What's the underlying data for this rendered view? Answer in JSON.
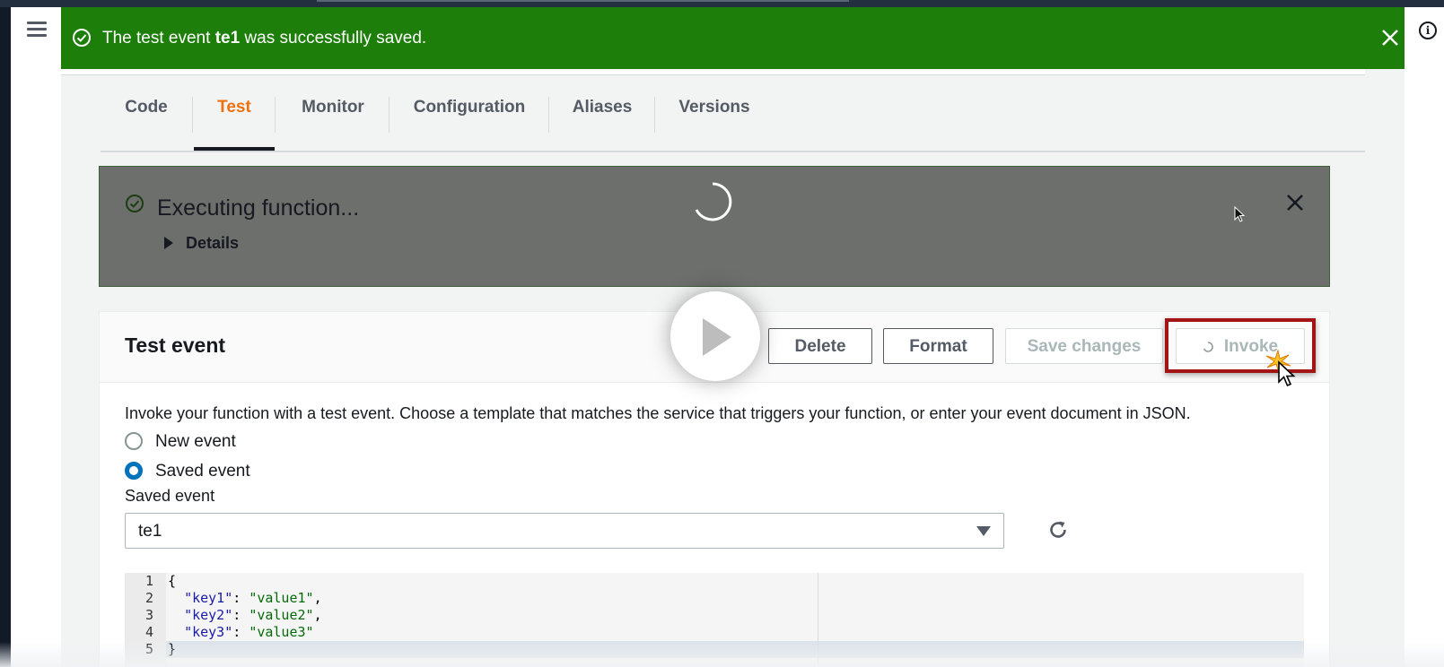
{
  "flash": {
    "prefix": "The test event ",
    "event_name": "te1",
    "suffix": " was successfully saved."
  },
  "tabs": [
    {
      "label": "Code",
      "active": false
    },
    {
      "label": "Test",
      "active": true
    },
    {
      "label": "Monitor",
      "active": false
    },
    {
      "label": "Configuration",
      "active": false
    },
    {
      "label": "Aliases",
      "active": false
    },
    {
      "label": "Versions",
      "active": false
    }
  ],
  "execution": {
    "title": "Executing function...",
    "details_label": "Details"
  },
  "test_event": {
    "title": "Test event",
    "buttons": {
      "delete": "Delete",
      "format": "Format",
      "save_changes": "Save changes",
      "invoke": "Invoke"
    },
    "description": "Invoke your function with a test event. Choose a template that matches the service that triggers your function, or enter your event document in JSON.",
    "options": {
      "new_event": "New event",
      "saved_event": "Saved event",
      "selected": "saved_event"
    },
    "saved_event_label": "Saved event",
    "saved_event_value": "te1",
    "editor": {
      "line_numbers": [
        "1",
        "2",
        "3",
        "4",
        "5"
      ],
      "lines": [
        {
          "text": "{"
        },
        {
          "key": "\"key1\"",
          "value": "\"value1\"",
          "trail": ","
        },
        {
          "key": "\"key2\"",
          "value": "\"value2\"",
          "trail": ","
        },
        {
          "key": "\"key3\"",
          "value": "\"value3\"",
          "trail": ""
        },
        {
          "text": "}"
        }
      ]
    }
  },
  "colors": {
    "success": "#1d7f09",
    "active_tab": "#ec7211",
    "radio_selected": "#0073bb",
    "highlight_border": "#a31515"
  }
}
